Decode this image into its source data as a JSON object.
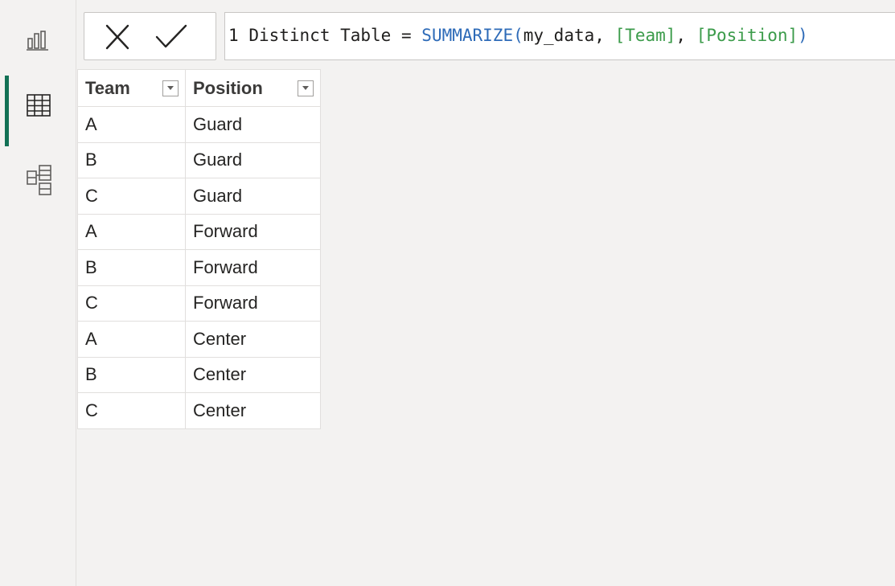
{
  "nav": {
    "items": [
      {
        "name": "report-view",
        "icon": "bar-chart-icon",
        "active": false
      },
      {
        "name": "data-view",
        "icon": "table-icon",
        "active": true
      },
      {
        "name": "model-view",
        "icon": "model-icon",
        "active": false
      }
    ],
    "accent": "#127155"
  },
  "formula_bar": {
    "line_number": "1",
    "table_name": "Distinct Table",
    "operator": "=",
    "function": "SUMMARIZE",
    "open_paren": "(",
    "arg_table": "my_data,",
    "arg_col1": "[Team]",
    "sep": ",",
    "arg_col2": "[Position]",
    "close_paren": ")"
  },
  "table": {
    "columns": [
      "Team",
      "Position"
    ],
    "rows": [
      [
        "A",
        "Guard"
      ],
      [
        "B",
        "Guard"
      ],
      [
        "C",
        "Guard"
      ],
      [
        "A",
        "Forward"
      ],
      [
        "B",
        "Forward"
      ],
      [
        "C",
        "Forward"
      ],
      [
        "A",
        "Center"
      ],
      [
        "B",
        "Center"
      ],
      [
        "C",
        "Center"
      ]
    ]
  }
}
